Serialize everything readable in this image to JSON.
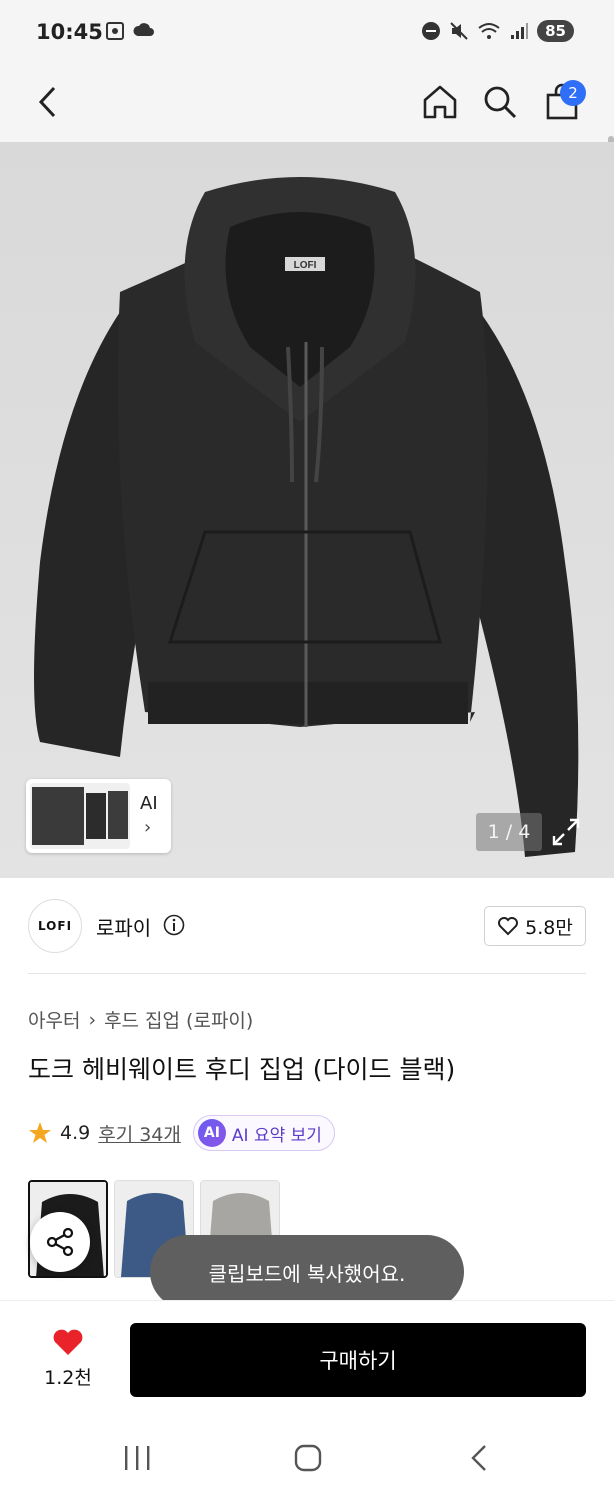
{
  "status_bar": {
    "time": "10:45",
    "battery": "85"
  },
  "header": {
    "cart_count": "2"
  },
  "gallery": {
    "counter": "1 / 4",
    "ai_label": "AI",
    "ai_chevron": "›"
  },
  "jacket_tag": "LOFI",
  "brand": {
    "logo_text": "LOFI",
    "name": "로파이",
    "likes": "5.8만"
  },
  "breadcrumb": {
    "category": "아우터",
    "separator": "›",
    "subcategory": "후드 집업 (로파이)"
  },
  "product": {
    "title": "도크 헤비웨이트 후디 집업 (다이드 블랙)"
  },
  "rating": {
    "score": "4.9",
    "reviews": "후기 34개",
    "ai_badge": "AI",
    "ai_summary": "AI 요약 보기"
  },
  "swatches": [
    {
      "color": "#1b1b1b"
    },
    {
      "color": "#3c5a85"
    },
    {
      "color": "#a8a6a2"
    }
  ],
  "toast": "클립보드에 복사했어요.",
  "bottom_bar": {
    "wish_count": "1.2천",
    "buy_label": "구매하기"
  },
  "colors": {
    "accent": "#2f6ef7",
    "heart": "#e8232a",
    "star": "#f5a623",
    "ai_purple": "#6a5cf0"
  }
}
